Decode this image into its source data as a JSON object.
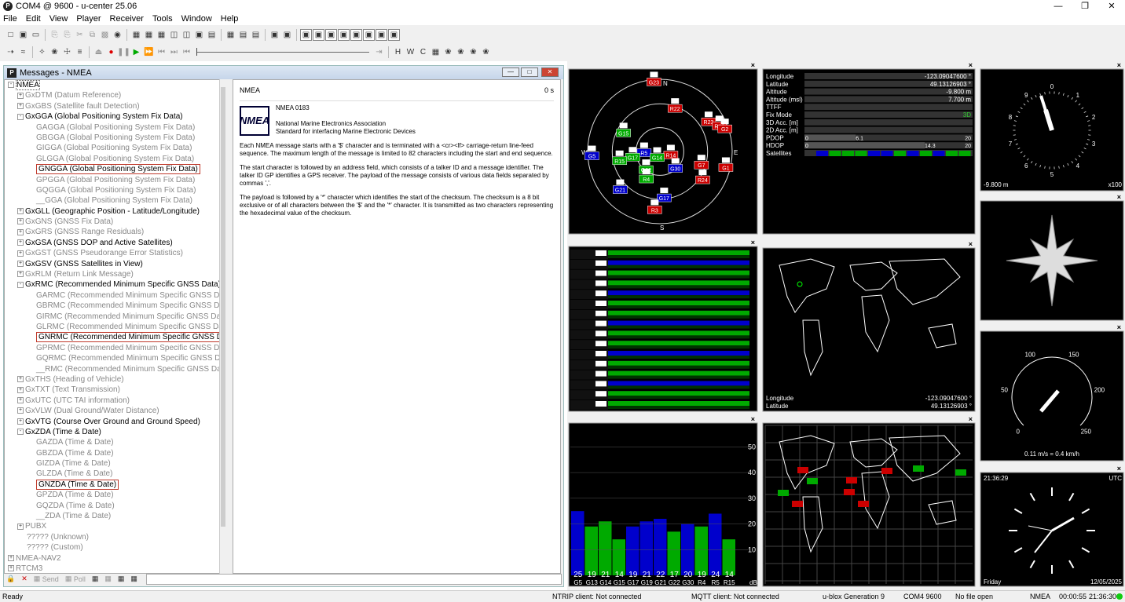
{
  "window": {
    "title": "COM4 @ 9600 - u-center 25.06"
  },
  "menu": [
    "File",
    "Edit",
    "View",
    "Player",
    "Receiver",
    "Tools",
    "Window",
    "Help"
  ],
  "messages": {
    "title": "Messages - NMEA",
    "tree": [
      {
        "text": "NMEA",
        "level": 0,
        "exp": "-",
        "cls": "bold",
        "sel": true
      },
      {
        "text": "GxDTM (Datum Reference)",
        "level": 1,
        "exp": "+",
        "cls": "gray"
      },
      {
        "text": "GxGBS (Satellite fault Detection)",
        "level": 1,
        "exp": "+",
        "cls": "gray"
      },
      {
        "text": "GxGGA (Global Positioning System Fix Data)",
        "level": 1,
        "exp": "-",
        "cls": "bold"
      },
      {
        "text": "GAGGA (Global Positioning System Fix Data)",
        "level": 2,
        "cls": "gray"
      },
      {
        "text": "GBGGA (Global Positioning System Fix Data)",
        "level": 2,
        "cls": "gray"
      },
      {
        "text": "GIGGA (Global Positioning System Fix Data)",
        "level": 2,
        "cls": "gray"
      },
      {
        "text": "GLGGA (Global Positioning System Fix Data)",
        "level": 2,
        "cls": "gray"
      },
      {
        "text": "GNGGA (Global Positioning System Fix Data)",
        "level": 2,
        "cls": "bold",
        "box": true
      },
      {
        "text": "GPGGA (Global Positioning System Fix Data)",
        "level": 2,
        "cls": "gray"
      },
      {
        "text": "GQGGA (Global Positioning System Fix Data)",
        "level": 2,
        "cls": "gray"
      },
      {
        "text": "__GGA (Global Positioning System Fix Data)",
        "level": 2,
        "cls": "gray"
      },
      {
        "text": "GxGLL (Geographic Position - Latitude/Longitude)",
        "level": 1,
        "exp": "+",
        "cls": "bold"
      },
      {
        "text": "GxGNS (GNSS Fix Data)",
        "level": 1,
        "exp": "+",
        "cls": "gray"
      },
      {
        "text": "GxGRS (GNSS Range Residuals)",
        "level": 1,
        "exp": "+",
        "cls": "gray"
      },
      {
        "text": "GxGSA (GNSS DOP and Active Satellites)",
        "level": 1,
        "exp": "+",
        "cls": "bold"
      },
      {
        "text": "GxGST (GNSS Pseudorange Error Statistics)",
        "level": 1,
        "exp": "+",
        "cls": "gray"
      },
      {
        "text": "GxGSV (GNSS Satellites in View)",
        "level": 1,
        "exp": "+",
        "cls": "bold"
      },
      {
        "text": "GxRLM (Return Link Message)",
        "level": 1,
        "exp": "+",
        "cls": "gray"
      },
      {
        "text": "GxRMC (Recommended Minimum Specific GNSS Data)",
        "level": 1,
        "exp": "-",
        "cls": "bold"
      },
      {
        "text": "GARMC (Recommended Minimum Specific GNSS Data)",
        "level": 2,
        "cls": "gray"
      },
      {
        "text": "GBRMC (Recommended Minimum Specific GNSS Data)",
        "level": 2,
        "cls": "gray"
      },
      {
        "text": "GIRMC (Recommended Minimum Specific GNSS Data)",
        "level": 2,
        "cls": "gray"
      },
      {
        "text": "GLRMC (Recommended Minimum Specific GNSS Data)",
        "level": 2,
        "cls": "gray"
      },
      {
        "text": "GNRMC (Recommended Minimum Specific GNSS Data)",
        "level": 2,
        "cls": "bold",
        "box": true
      },
      {
        "text": "GPRMC (Recommended Minimum Specific GNSS Data)",
        "level": 2,
        "cls": "gray"
      },
      {
        "text": "GQRMC (Recommended Minimum Specific GNSS Data)",
        "level": 2,
        "cls": "gray"
      },
      {
        "text": "__RMC (Recommended Minimum Specific GNSS Data)",
        "level": 2,
        "cls": "gray"
      },
      {
        "text": "GxTHS (Heading of Vehicle)",
        "level": 1,
        "exp": "+",
        "cls": "gray"
      },
      {
        "text": "GxTXT (Text Transmission)",
        "level": 1,
        "exp": "+",
        "cls": "gray"
      },
      {
        "text": "GxUTC (UTC TAI information)",
        "level": 1,
        "exp": "+",
        "cls": "gray"
      },
      {
        "text": "GxVLW (Dual Ground/Water Distance)",
        "level": 1,
        "exp": "+",
        "cls": "gray"
      },
      {
        "text": "GxVTG (Course Over Ground and Ground Speed)",
        "level": 1,
        "exp": "+",
        "cls": "bold"
      },
      {
        "text": "GxZDA (Time & Date)",
        "level": 1,
        "exp": "-",
        "cls": "bold"
      },
      {
        "text": "GAZDA (Time & Date)",
        "level": 2,
        "cls": "gray"
      },
      {
        "text": "GBZDA (Time & Date)",
        "level": 2,
        "cls": "gray"
      },
      {
        "text": "GIZDA (Time & Date)",
        "level": 2,
        "cls": "gray"
      },
      {
        "text": "GLZDA (Time & Date)",
        "level": 2,
        "cls": "gray"
      },
      {
        "text": "GNZDA (Time & Date)",
        "level": 2,
        "cls": "bold",
        "box": true
      },
      {
        "text": "GPZDA (Time & Date)",
        "level": 2,
        "cls": "gray"
      },
      {
        "text": "GQZDA (Time & Date)",
        "level": 2,
        "cls": "gray"
      },
      {
        "text": "__ZDA (Time & Date)",
        "level": 2,
        "cls": "gray"
      },
      {
        "text": "PUBX",
        "level": 1,
        "exp": "+",
        "cls": "gray"
      },
      {
        "text": "????? (Unknown)",
        "level": 1,
        "cls": "gray"
      },
      {
        "text": "????? (Custom)",
        "level": 1,
        "cls": "gray"
      },
      {
        "text": "NMEA-NAV2",
        "level": 0,
        "exp": "+",
        "cls": "gray"
      },
      {
        "text": "RTCM3",
        "level": 0,
        "exp": "+",
        "cls": "gray"
      }
    ],
    "info": {
      "header": "NMEA",
      "count": "0 s",
      "logo_text": "NMEA",
      "std": "NMEA 0183",
      "org1": "National Marine Electronics Association",
      "org2": "Standard for interfacing Marine Electronic Devices",
      "p1": "Each NMEA message starts with a '$' character and is terminated with a <cr><lf> carriage-return line-feed sequence. The maximum length of the message is limited to 82 characters including the start and end sequence.",
      "p2": "The start character is followed by an address field, which consists of a talker ID and a message identifier. The talker ID GP identifies a GPS receiver. The payload of the message consists of various data fields separated by commas ','.",
      "p3": "The payload is followed by a '*' character which identifies the start of the checksum. The checksum is a 8 bit exclusive or of all characters between the '$' and the '*' character. It is transmitted as two characters representing the hexadecimal value of the checksum."
    },
    "bottom": {
      "send": "Send",
      "poll": "Poll"
    }
  },
  "dataview": {
    "rows": [
      {
        "label": "Longitude",
        "value": "-123.09047600 °"
      },
      {
        "label": "Latitude",
        "value": "49.13126903 °"
      },
      {
        "label": "Altitude",
        "value": "-9.800 m"
      },
      {
        "label": "Altitude (msl)",
        "value": "7.700 m"
      },
      {
        "label": "TTFF",
        "value": ""
      },
      {
        "label": "Fix Mode",
        "value": "3D"
      },
      {
        "label": "3D Acc. [m]",
        "value": ""
      },
      {
        "label": "2D Acc. [m]",
        "value": ""
      },
      {
        "label": "PDOP",
        "value": ""
      },
      {
        "label": "HDOP",
        "value": ""
      },
      {
        "label": "Satellites",
        "value": ""
      }
    ],
    "pdop": {
      "min": "0",
      "val": "6.1",
      "max": "20",
      "fraction": 0.305
    },
    "hdop": {
      "min": "0",
      "val": "14.3",
      "max": "20",
      "fraction": 0.715
    }
  },
  "skyview": {
    "n": "N",
    "e": "E",
    "s": "S",
    "w": "W",
    "sats": [
      {
        "id": "G23",
        "az": 355,
        "el": 5,
        "c": "#c00"
      },
      {
        "id": "R22",
        "az": 20,
        "el": 35,
        "c": "#c00"
      },
      {
        "id": "G15",
        "az": 295,
        "el": 40,
        "c": "#0a0"
      },
      {
        "id": "R5",
        "az": 260,
        "el": 70,
        "c": "#00c"
      },
      {
        "id": "G17",
        "az": 255,
        "el": 55,
        "c": "#0a0"
      },
      {
        "id": "R14",
        "az": 115,
        "el": 75,
        "c": "#c00"
      },
      {
        "id": "R23",
        "az": 60,
        "el": 20,
        "c": "#c00"
      },
      {
        "id": "R13",
        "az": 68,
        "el": 10,
        "c": "#c00"
      },
      {
        "id": "G2",
        "az": 72,
        "el": 5,
        "c": "#c00"
      },
      {
        "id": "R15",
        "az": 255,
        "el": 38,
        "c": "#0a0"
      },
      {
        "id": "G14",
        "az": 200,
        "el": 80,
        "c": "#0a0"
      },
      {
        "id": "G30",
        "az": 140,
        "el": 60,
        "c": "#00c"
      },
      {
        "id": "G7",
        "az": 110,
        "el": 35,
        "c": "#c00"
      },
      {
        "id": "G1",
        "az": 105,
        "el": 5,
        "c": "#c00"
      },
      {
        "id": "G5",
        "az": 265,
        "el": 5,
        "c": "#00c"
      },
      {
        "id": "G22",
        "az": 215,
        "el": 60,
        "c": "#0a0"
      },
      {
        "id": "R4",
        "az": 205,
        "el": 50,
        "c": "#0a0"
      },
      {
        "id": "R24",
        "az": 125,
        "el": 25,
        "c": "#c00"
      },
      {
        "id": "G21",
        "az": 225,
        "el": 20,
        "c": "#00c"
      },
      {
        "id": "G17b",
        "label": "G17",
        "az": 175,
        "el": 30,
        "c": "#00c"
      },
      {
        "id": "R3",
        "az": 185,
        "el": 15,
        "c": "#c00"
      }
    ]
  },
  "clock": {
    "bottom_left": "-9.800 m",
    "bottom_right": "x100",
    "numbers": [
      "0",
      "1",
      "2",
      "3",
      "4",
      "5",
      "6",
      "7",
      "8",
      "9"
    ]
  },
  "speed": {
    "labels": [
      "0",
      "50",
      "100",
      "150",
      "200",
      "250"
    ],
    "text": "0.11 m/s = 0.4 km/h"
  },
  "time": {
    "time": "21:36:29",
    "tz": "UTC",
    "day": "Friday",
    "date": "12/05/2025"
  },
  "worldview": {
    "lon_label": "Longitude",
    "lon": "-123.09047600 °",
    "lat_label": "Latitude",
    "lat": "49.13126903 °"
  },
  "chart_data": {
    "type": "bar",
    "categories": [
      "G5",
      "G13",
      "G14",
      "G15",
      "G17",
      "G19",
      "G21",
      "G22",
      "G30",
      "R4",
      "R5",
      "R15"
    ],
    "values": [
      25,
      19,
      21,
      14,
      19,
      21,
      22,
      17,
      20,
      19,
      24,
      14
    ],
    "ylim": [
      0,
      55
    ],
    "yticks": [
      "10",
      "20",
      "30",
      "40",
      "50"
    ],
    "colors": [
      "#00c",
      "#0a0",
      "#0a0",
      "#0a0",
      "#00c",
      "#00c",
      "#00c",
      "#0a0",
      "#00c",
      "#0a0",
      "#00c",
      "#0a0"
    ],
    "unit": "dB"
  },
  "status": {
    "ready": "Ready",
    "ntrip": "NTRIP client: Not connected",
    "mqtt": "MQTT client: Not connected",
    "gen": "u-blox Generation 9",
    "port": "COM4 9600",
    "file": "No file open",
    "proto": "NMEA",
    "elapsed": "00:00:55",
    "clock": "21:36:30"
  }
}
